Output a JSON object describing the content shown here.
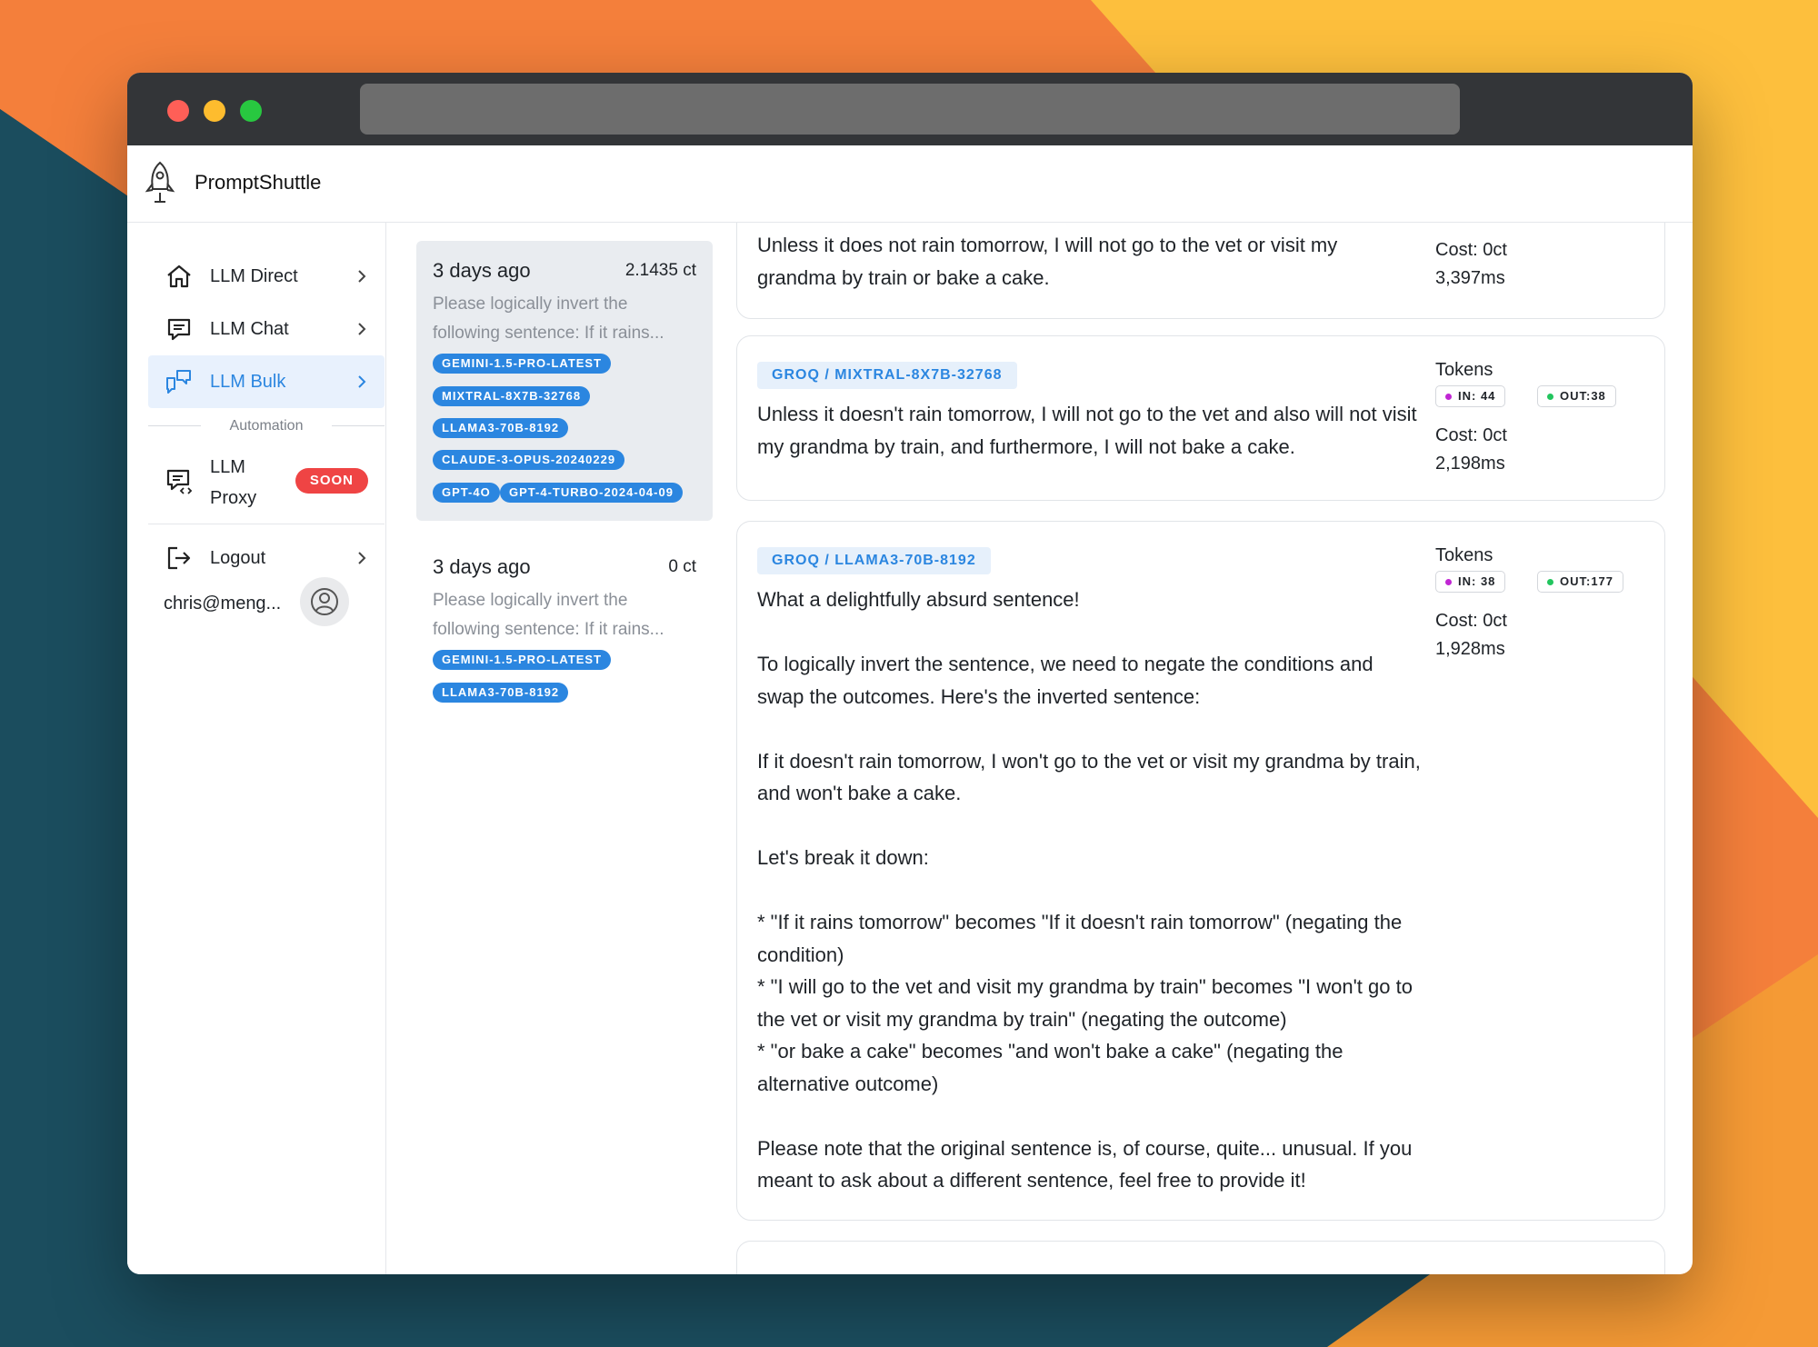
{
  "app": {
    "name": "PromptShuttle"
  },
  "sidebar": {
    "items": [
      {
        "label": "LLM Direct",
        "icon": "home-icon"
      },
      {
        "label": "LLM Chat",
        "icon": "chat-icon"
      },
      {
        "label": "LLM Bulk",
        "icon": "bulk-chat-icon",
        "active": true
      }
    ],
    "section_label": "Automation",
    "proxy": {
      "label": "LLM Proxy",
      "badge": "SOON",
      "icon": "proxy-chat-icon"
    },
    "logout": {
      "label": "Logout",
      "icon": "logout-icon"
    },
    "user": {
      "email": "chris@meng..."
    }
  },
  "history": [
    {
      "date": "3 days ago",
      "cost": "2.1435 ct",
      "snippet": "Please logically invert the following sentence: If it rains...",
      "models": [
        "GEMINI-1.5-PRO-LATEST",
        "MIXTRAL-8X7B-32768",
        "LLAMA3-70B-8192",
        "CLAUDE-3-OPUS-20240229",
        "GPT-4O",
        "GPT-4-TURBO-2024-04-09"
      ]
    },
    {
      "date": "3 days ago",
      "cost": "0 ct",
      "snippet": "Please logically invert the following sentence: If it rains...",
      "models": [
        "GEMINI-1.5-PRO-LATEST",
        "LLAMA3-70B-8192"
      ]
    }
  ],
  "results": [
    {
      "text": "Unless it does not rain tomorrow, I will not go to the vet or visit my grandma by train or bake a cake.",
      "cost": "Cost: 0ct",
      "time": "3,397ms"
    },
    {
      "model": "GROQ / MIXTRAL-8X7B-32768",
      "text": "Unless it doesn't rain tomorrow, I will not go to the vet and also will not visit my grandma by train, and furthermore, I will not bake a cake.",
      "tokens_label": "Tokens",
      "in": "IN: 44",
      "out": "OUT:38",
      "cost": "Cost: 0ct",
      "time": "2,198ms"
    },
    {
      "model": "GROQ / LLAMA3-70B-8192",
      "text": "What a delightfully absurd sentence!\n\nTo logically invert the sentence, we need to negate the conditions and swap the outcomes. Here's the inverted sentence:\n\nIf it doesn't rain tomorrow, I won't go to the vet or visit my grandma by train, and won't bake a cake.\n\nLet's break it down:\n\n* \"If it rains tomorrow\" becomes \"If it doesn't rain tomorrow\" (negating the condition)\n* \"I will go to the vet and visit my grandma by train\" becomes \"I won't go to the vet or visit my grandma by train\" (negating the outcome)\n* \"or bake a cake\" becomes \"and won't bake a cake\" (negating the alternative outcome)\n\nPlease note that the original sentence is, of course, quite... unusual. If you meant to ask about a different sentence, feel free to provide it!",
      "tokens_label": "Tokens",
      "in": "IN: 38",
      "out": "OUT:177",
      "cost": "Cost: 0ct",
      "time": "1,928ms"
    }
  ],
  "colors": {
    "accent": "#2b86e0",
    "soon_badge": "#ef4444",
    "in_dot": "#c026d3",
    "out_dot": "#22c55e"
  }
}
